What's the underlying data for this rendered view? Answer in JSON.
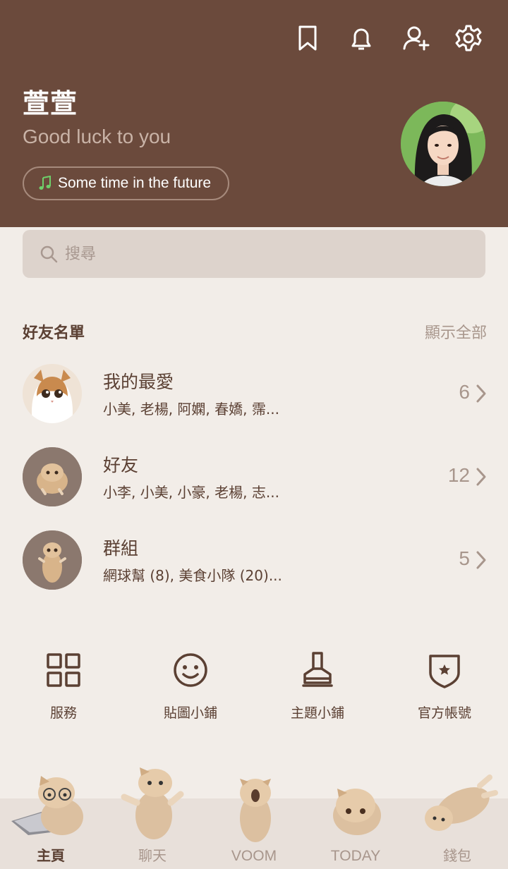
{
  "header": {
    "background": "#6b4a3c",
    "icons": [
      "bookmark-icon",
      "bell-icon",
      "add-friend-icon",
      "gear-icon"
    ],
    "profile": {
      "name": "萱萱",
      "status": "Good luck to you",
      "music": "Some time in the future"
    }
  },
  "search": {
    "placeholder": "搜尋"
  },
  "friends": {
    "title": "好友名單",
    "show_all": "顯示全部",
    "rows": [
      {
        "title": "我的最愛",
        "subtitle": "小美, 老楊, 阿嫻, 春嬌, 霈...",
        "count": "6"
      },
      {
        "title": "好友",
        "subtitle": "小李, 小美, 小豪, 老楊, 志...",
        "count": "12"
      },
      {
        "title": "群組",
        "subtitle": "網球幫 (8), 美食小隊 (20)...",
        "count": "5"
      }
    ]
  },
  "shortcuts": [
    {
      "label": "服務",
      "icon": "grid-icon"
    },
    {
      "label": "貼圖小鋪",
      "icon": "smiley-icon"
    },
    {
      "label": "主題小鋪",
      "icon": "brush-icon"
    },
    {
      "label": "官方帳號",
      "icon": "shield-star-icon"
    }
  ],
  "bottom_nav": {
    "items": [
      {
        "label": "主頁",
        "active": true
      },
      {
        "label": "聊天",
        "active": false
      },
      {
        "label": "VOOM",
        "active": false
      },
      {
        "label": "TODAY",
        "active": false
      },
      {
        "label": "錢包",
        "active": false
      }
    ]
  },
  "colors": {
    "accent_dark": "#5b4033",
    "muted": "#a8968c",
    "background": "#f2ede8",
    "music_note": "#6fd06a"
  }
}
